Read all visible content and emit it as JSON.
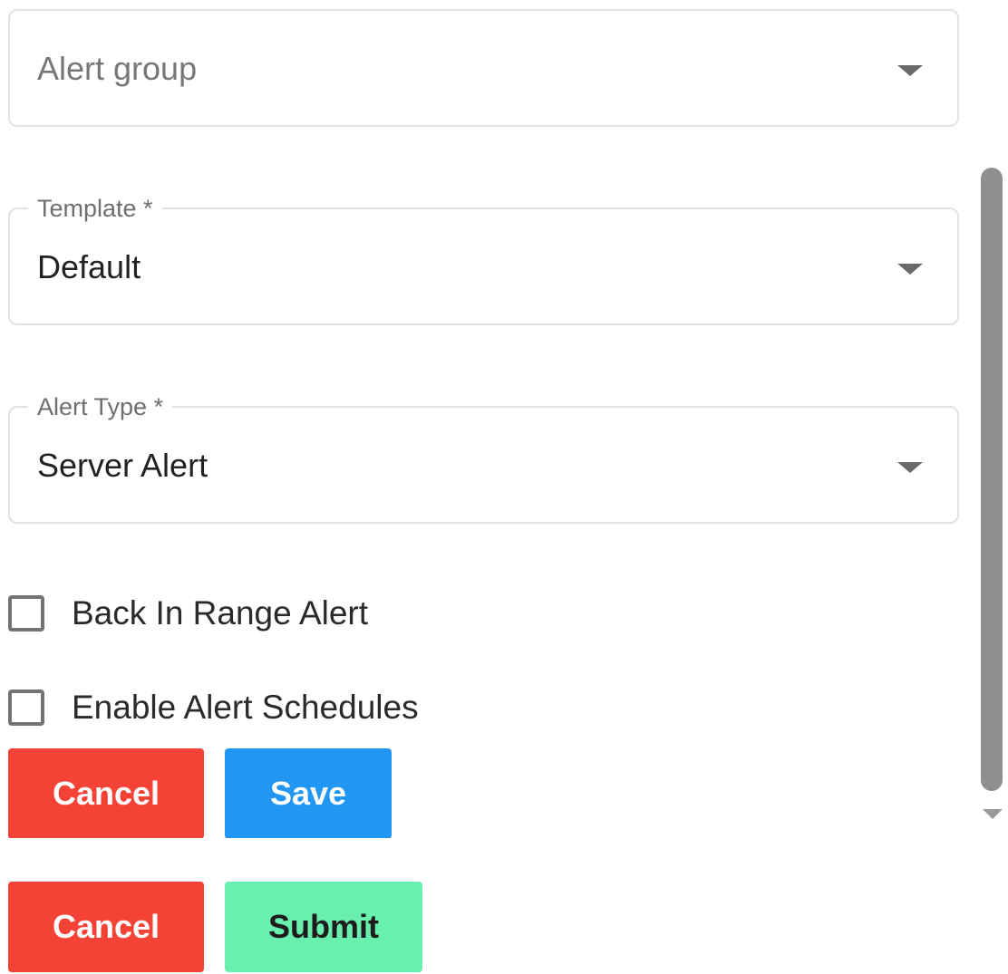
{
  "form": {
    "alert_group": {
      "placeholder": "Alert group",
      "value": ""
    },
    "template": {
      "label": "Template *",
      "value": "Default"
    },
    "alert_type": {
      "label": "Alert Type *",
      "value": "Server Alert"
    },
    "back_in_range": {
      "label": "Back In Range Alert",
      "checked": false
    },
    "enable_schedules": {
      "label": "Enable Alert Schedules",
      "checked": false
    }
  },
  "inner_actions": {
    "cancel_label": "Cancel",
    "save_label": "Save"
  },
  "outer_actions": {
    "cancel_label": "Cancel",
    "submit_label": "Submit"
  },
  "icons": {
    "dropdown": "chevron-down-icon",
    "scroll_down": "scroll-down-arrow-icon"
  },
  "colors": {
    "cancel": "#f44336",
    "save": "#2196f3",
    "submit": "#69f0ae"
  }
}
